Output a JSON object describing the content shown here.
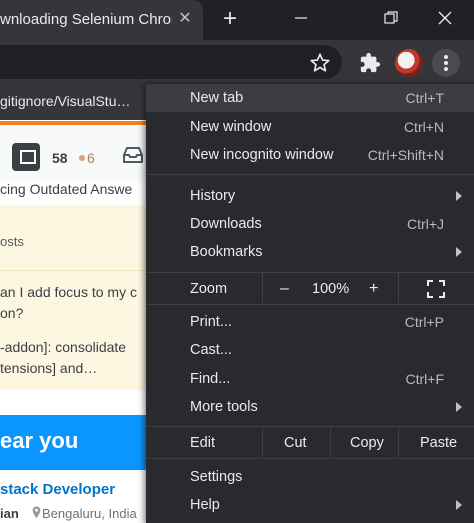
{
  "tab": {
    "title": "wnloading Selenium Chrom",
    "close": "✕"
  },
  "new_tab_button": "+",
  "bookmarks_bar": {
    "text": "gitignore/VisualStu…"
  },
  "page": {
    "reputation": "58",
    "bronze_badges": "6",
    "banner_text": "cing Outdated Answe",
    "posts_heading": "osts",
    "post_lines": [
      "an I add focus to my c",
      "on?",
      "-addon]: consolidate",
      "tensions] and…"
    ],
    "hiring_banner": "ear you",
    "job_title": "stack Developer",
    "job_company": "ian",
    "job_location": "Bengaluru, India"
  },
  "menu": {
    "new_tab": {
      "label": "New tab",
      "shortcut": "Ctrl+T"
    },
    "new_window": {
      "label": "New window",
      "shortcut": "Ctrl+N"
    },
    "new_incognito": {
      "label": "New incognito window",
      "shortcut": "Ctrl+Shift+N"
    },
    "history": {
      "label": "History"
    },
    "downloads": {
      "label": "Downloads",
      "shortcut": "Ctrl+J"
    },
    "bookmarks": {
      "label": "Bookmarks"
    },
    "zoom": {
      "label": "Zoom",
      "minus": "–",
      "level": "100%",
      "plus": "+"
    },
    "print": {
      "label": "Print...",
      "shortcut": "Ctrl+P"
    },
    "cast": {
      "label": "Cast..."
    },
    "find": {
      "label": "Find...",
      "shortcut": "Ctrl+F"
    },
    "more_tools": {
      "label": "More tools"
    },
    "edit": {
      "label": "Edit",
      "cut": "Cut",
      "copy": "Copy",
      "paste": "Paste"
    },
    "settings": {
      "label": "Settings"
    },
    "help": {
      "label": "Help"
    }
  },
  "colors": {
    "menu_bg": "#292a2d",
    "highlight": "#3c3d41",
    "accent_orange": "#f48024",
    "hiring_blue": "#0a95ff"
  }
}
